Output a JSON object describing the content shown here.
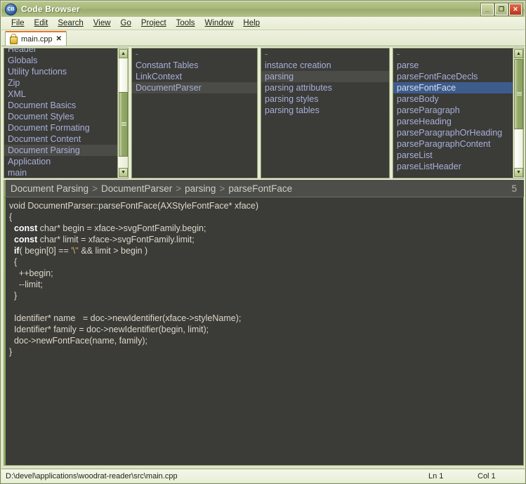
{
  "window": {
    "title": "Code Browser",
    "icon": "app-icon",
    "controls": [
      {
        "name": "minimize",
        "glyph": "_"
      },
      {
        "name": "maximize",
        "glyph": "❐"
      },
      {
        "name": "close",
        "glyph": "✕"
      }
    ]
  },
  "menu": [
    {
      "label": "File",
      "accel": "F"
    },
    {
      "label": "Edit",
      "accel": "E"
    },
    {
      "label": "Search",
      "accel": "S"
    },
    {
      "label": "View",
      "accel": "V"
    },
    {
      "label": "Go",
      "accel": "G"
    },
    {
      "label": "Project",
      "accel": "P"
    },
    {
      "label": "Tools",
      "accel": "T"
    },
    {
      "label": "Window",
      "accel": "W"
    },
    {
      "label": "Help",
      "accel": "H"
    }
  ],
  "tabs": [
    {
      "label": "main.cpp",
      "icon": "lock-icon",
      "close": "✕",
      "active": true
    }
  ],
  "panels": [
    {
      "name": "modules",
      "scrolled": true,
      "has_scrollbar": true,
      "items": [
        {
          "label": "Header",
          "state": "clipped"
        },
        {
          "label": "Globals",
          "state": "normal"
        },
        {
          "label": "Utility functions",
          "state": "normal"
        },
        {
          "label": "Zip",
          "state": "normal"
        },
        {
          "label": "XML",
          "state": "normal"
        },
        {
          "label": "Document Basics",
          "state": "normal"
        },
        {
          "label": "Document Styles",
          "state": "normal"
        },
        {
          "label": "Document Formating",
          "state": "normal"
        },
        {
          "label": "Document Content",
          "state": "normal"
        },
        {
          "label": "Document Parsing",
          "state": "selected-gray"
        },
        {
          "label": "Application",
          "state": "normal"
        },
        {
          "label": "main",
          "state": "normal"
        }
      ]
    },
    {
      "name": "classes",
      "scrolled": false,
      "has_scrollbar": false,
      "items": [
        {
          "label": "-",
          "state": "dash"
        },
        {
          "label": "Constant Tables",
          "state": "normal"
        },
        {
          "label": "LinkContext",
          "state": "normal"
        },
        {
          "label": "DocumentParser",
          "state": "selected-gray"
        }
      ]
    },
    {
      "name": "categories",
      "scrolled": false,
      "has_scrollbar": false,
      "items": [
        {
          "label": "-",
          "state": "dash"
        },
        {
          "label": "instance creation",
          "state": "normal"
        },
        {
          "label": "parsing",
          "state": "selected-gray"
        },
        {
          "label": "parsing attributes",
          "state": "normal"
        },
        {
          "label": "parsing styles",
          "state": "normal"
        },
        {
          "label": "parsing tables",
          "state": "normal"
        }
      ]
    },
    {
      "name": "members",
      "scrolled": false,
      "has_scrollbar": true,
      "items": [
        {
          "label": "-",
          "state": "dash"
        },
        {
          "label": "parse",
          "state": "normal"
        },
        {
          "label": "parseFontFaceDecls",
          "state": "normal"
        },
        {
          "label": "parseFontFace",
          "state": "selected-blue"
        },
        {
          "label": "parseBody",
          "state": "normal"
        },
        {
          "label": "parseParagraph",
          "state": "normal"
        },
        {
          "label": "parseHeading",
          "state": "normal"
        },
        {
          "label": "parseParagraphOrHeading",
          "state": "normal"
        },
        {
          "label": "parseParagraphContent",
          "state": "normal"
        },
        {
          "label": "parseList",
          "state": "normal"
        },
        {
          "label": "parseListHeader",
          "state": "normal"
        }
      ]
    }
  ],
  "breadcrumb": {
    "crumbs": [
      "Document Parsing",
      "DocumentParser",
      "parsing",
      "parseFontFace"
    ],
    "separator": ">",
    "count": "5"
  },
  "code": {
    "lines": [
      [
        {
          "t": "void DocumentParser::parseFontFace(AXStyleFontFace* xface)",
          "c": "plain"
        }
      ],
      [
        {
          "t": "{",
          "c": "plain"
        }
      ],
      [
        {
          "t": "  ",
          "c": "plain"
        },
        {
          "t": "const",
          "c": "kw"
        },
        {
          "t": " char* begin = xface->svgFontFamily.begin;",
          "c": "plain"
        }
      ],
      [
        {
          "t": "  ",
          "c": "plain"
        },
        {
          "t": "const",
          "c": "kw"
        },
        {
          "t": " char* limit = xface->svgFontFamily.limit;",
          "c": "plain"
        }
      ],
      [
        {
          "t": "  ",
          "c": "plain"
        },
        {
          "t": "if",
          "c": "kw"
        },
        {
          "t": "( begin[0] == ",
          "c": "plain"
        },
        {
          "t": "'\\''",
          "c": "lit"
        },
        {
          "t": " && limit > begin )",
          "c": "plain"
        }
      ],
      [
        {
          "t": "  {",
          "c": "plain"
        }
      ],
      [
        {
          "t": "    ++begin;",
          "c": "plain"
        }
      ],
      [
        {
          "t": "    --limit;",
          "c": "plain"
        }
      ],
      [
        {
          "t": "  }",
          "c": "plain"
        }
      ],
      [
        {
          "t": "",
          "c": "plain"
        }
      ],
      [
        {
          "t": "  Identifier* name   = doc->newIdentifier(xface->styleName);",
          "c": "plain"
        }
      ],
      [
        {
          "t": "  Identifier* family = doc->newIdentifier(begin, limit);",
          "c": "plain"
        }
      ],
      [
        {
          "t": "  doc->newFontFace(name, family);",
          "c": "plain"
        }
      ],
      [
        {
          "t": "}",
          "c": "plain"
        }
      ]
    ]
  },
  "statusbar": {
    "path": "D:\\devel\\applications\\woodrat-reader\\src\\main.cpp",
    "line": "Ln 1",
    "column": "Col 1"
  },
  "colors": {
    "titlebar": "#a8b87a",
    "chrome": "#dfe6c8",
    "panel_bg": "#3b3b38",
    "list_text": "#a8b0d8",
    "select_blue": "#3d5c8c",
    "select_gray": "#4b4b47",
    "accent_green": "#8fa86a",
    "tab_accent": "#e07a28",
    "close_red": "#b8321a"
  }
}
